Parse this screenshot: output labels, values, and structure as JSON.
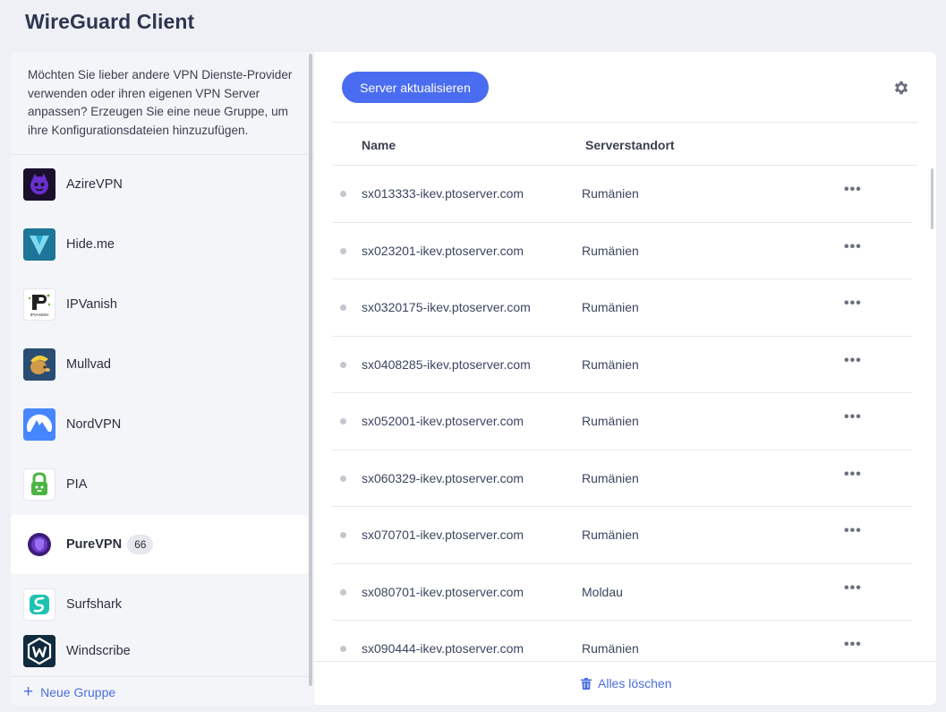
{
  "app": {
    "title": "WireGuard Client"
  },
  "sidebar": {
    "intro": "Möchten Sie lieber andere VPN Dienste-Provider verwenden oder ihren eigenen VPN Server anpassen? Erzeugen Sie eine neue Gruppe, um ihre Konfigurationsdateien hinzuzufügen.",
    "providers": [
      {
        "name": "AzireVPN",
        "icon": "azirevpn-logo-icon"
      },
      {
        "name": "Hide.me",
        "icon": "hideme-logo-icon"
      },
      {
        "name": "IPVanish",
        "icon": "ipvanish-logo-icon",
        "logo_text": "IPVANISH"
      },
      {
        "name": "Mullvad",
        "icon": "mullvad-logo-icon"
      },
      {
        "name": "NordVPN",
        "icon": "nordvpn-logo-icon"
      },
      {
        "name": "PIA",
        "icon": "pia-logo-icon"
      },
      {
        "name": "PureVPN",
        "icon": "purevpn-logo-icon",
        "count": "66",
        "selected": true
      },
      {
        "name": "Surfshark",
        "icon": "surfshark-logo-icon"
      },
      {
        "name": "Windscribe",
        "icon": "windscribe-logo-icon"
      }
    ],
    "new_group_label": "Neue Gruppe"
  },
  "main": {
    "refresh_label": "Server aktualisieren",
    "settings_icon": "gear-icon",
    "columns": {
      "name": "Name",
      "location": "Serverstandort"
    },
    "servers": [
      {
        "host": "sx013333-ikev.ptoserver.com",
        "location": "Rumänien"
      },
      {
        "host": "sx023201-ikev.ptoserver.com",
        "location": "Rumänien"
      },
      {
        "host": "sx0320175-ikev.ptoserver.com",
        "location": "Rumänien"
      },
      {
        "host": "sx0408285-ikev.ptoserver.com",
        "location": "Rumänien"
      },
      {
        "host": "sx052001-ikev.ptoserver.com",
        "location": "Rumänien"
      },
      {
        "host": "sx060329-ikev.ptoserver.com",
        "location": "Rumänien"
      },
      {
        "host": "sx070701-ikev.ptoserver.com",
        "location": "Rumänien"
      },
      {
        "host": "sx080701-ikev.ptoserver.com",
        "location": "Moldau"
      },
      {
        "host": "sx090444-ikev.ptoserver.com",
        "location": "Rumänien"
      }
    ],
    "more_glyph": "•••",
    "clear_all_label": "Alles löschen"
  },
  "colors": {
    "accent": "#4a6cf1",
    "link": "#4a6ee0",
    "background": "#eef0f5"
  }
}
